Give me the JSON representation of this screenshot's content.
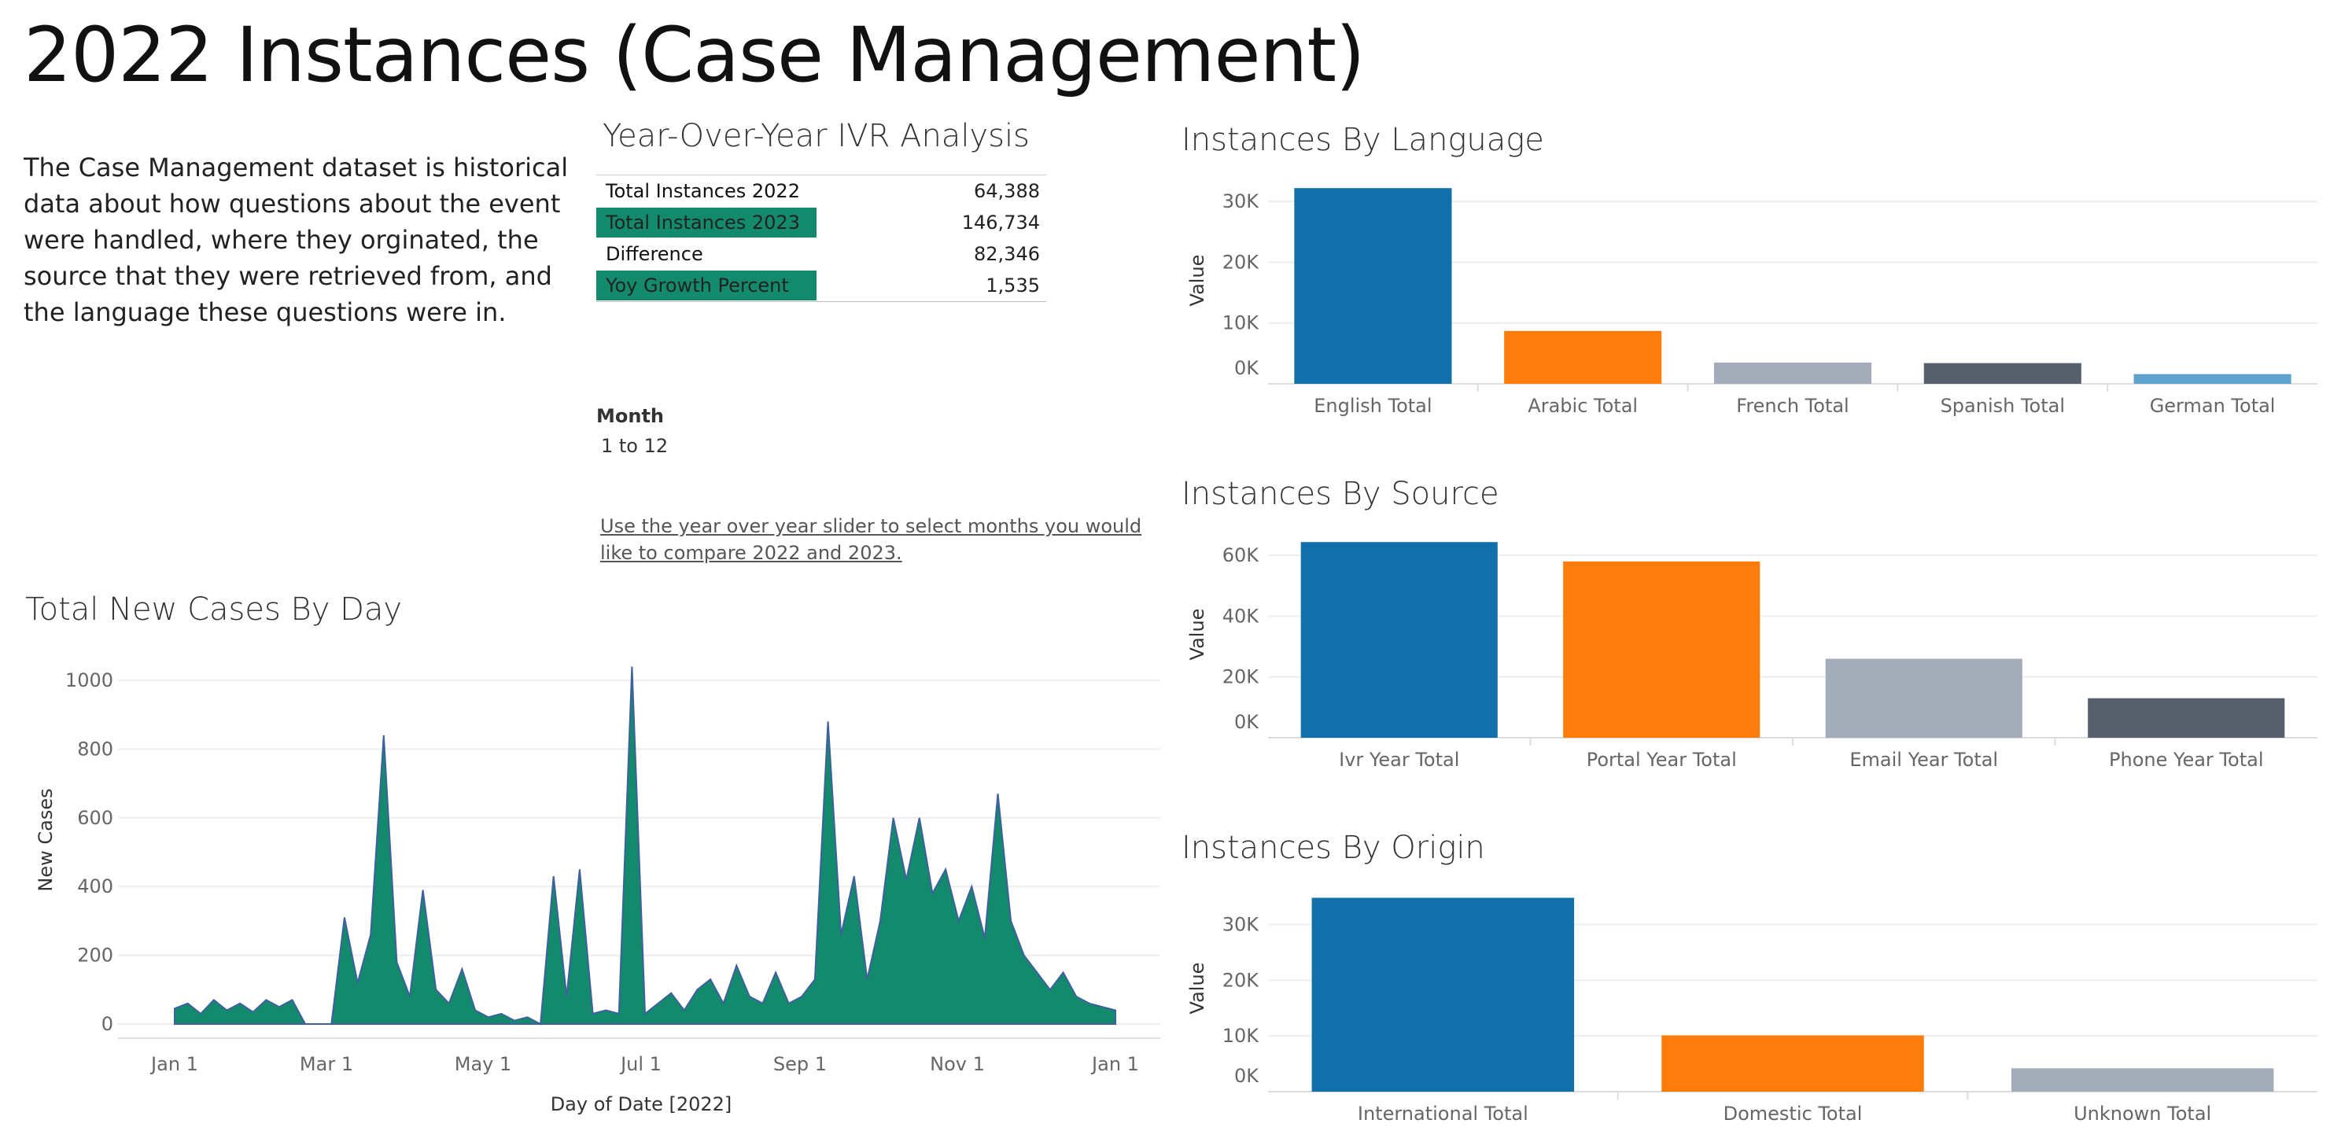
{
  "title": "2022 Instances (Case Management)",
  "description": "The Case Management dataset is historical data about how questions about the event were handled, where they orginated, the source that they were retrieved from, and the language these questions were in.",
  "yoy": {
    "title": "Year-Over-Year IVR Analysis",
    "rows": [
      {
        "label": "Total Instances 2022",
        "value": "64,388",
        "highlight": false
      },
      {
        "label": "Total Instances 2023",
        "value": "146,734",
        "highlight": true
      },
      {
        "label": "Difference",
        "value": "82,346",
        "highlight": false
      },
      {
        "label": "Yoy Growth Percent",
        "value": "1,535",
        "highlight": true
      }
    ]
  },
  "filter": {
    "label": "Month",
    "value": "1 to 12"
  },
  "hint": "Use the year over year slider to select months you would like to compare 2022 and 2023.",
  "colors": {
    "blue": "#1170aa",
    "orange": "#fc7d0b",
    "gray": "#a3acb9",
    "dark_gray": "#57606c",
    "light_blue": "#5fa2ce",
    "green": "#138a6b",
    "line": "#3f5f9e"
  },
  "chart_data": [
    {
      "id": "line",
      "type": "area",
      "title": "Total New Cases By Day",
      "xlabel": "Day of Date [2022]",
      "ylabel": "New Cases",
      "ylim": [
        0,
        1000
      ],
      "yticks": [
        "0",
        "200",
        "400",
        "600",
        "800",
        "1000"
      ],
      "xticks": [
        "Jan 1",
        "Mar 1",
        "May 1",
        "Jul 1",
        "Sep 1",
        "Nov 1",
        "Jan 1"
      ],
      "x": [
        "Jan 1",
        "Jan 6",
        "Jan 11",
        "Jan 16",
        "Jan 21",
        "Jan 26",
        "Jan 31",
        "Feb 5",
        "Feb 10",
        "Feb 15",
        "Feb 20",
        "Feb 25",
        "Mar 2",
        "Mar 7",
        "Mar 12",
        "Mar 17",
        "Mar 22",
        "Mar 27",
        "Apr 1",
        "Apr 6",
        "Apr 11",
        "Apr 16",
        "Apr 21",
        "Apr 26",
        "May 1",
        "May 6",
        "May 11",
        "May 16",
        "May 21",
        "May 26",
        "May 31",
        "Jun 5",
        "Jun 10",
        "Jun 15",
        "Jun 20",
        "Jun 25",
        "Jun 30",
        "Jul 5",
        "Jul 10",
        "Jul 15",
        "Jul 20",
        "Jul 25",
        "Jul 30",
        "Aug 4",
        "Aug 9",
        "Aug 14",
        "Aug 19",
        "Aug 24",
        "Aug 29",
        "Sep 3",
        "Sep 8",
        "Sep 13",
        "Sep 18",
        "Sep 23",
        "Sep 28",
        "Oct 3",
        "Oct 8",
        "Oct 13",
        "Oct 18",
        "Oct 23",
        "Oct 28",
        "Nov 2",
        "Nov 7",
        "Nov 12",
        "Nov 17",
        "Nov 22",
        "Nov 27",
        "Dec 2",
        "Dec 7",
        "Dec 12",
        "Dec 17",
        "Dec 22",
        "Dec 27"
      ],
      "series": [
        {
          "values": [
            45,
            60,
            30,
            70,
            40,
            60,
            35,
            70,
            50,
            70,
            0,
            0,
            0,
            310,
            120,
            260,
            840,
            180,
            80,
            390,
            100,
            60,
            160,
            40,
            20,
            30,
            10,
            20,
            0,
            430,
            80,
            450,
            30,
            40,
            30,
            1040,
            30,
            60,
            90,
            40,
            100,
            130,
            60,
            170,
            80,
            60,
            150,
            60,
            80,
            130,
            880,
            260,
            430,
            130,
            300,
            600,
            420,
            600,
            380,
            450,
            300,
            400,
            250,
            670,
            300,
            200,
            150,
            100,
            150,
            80,
            60,
            50,
            40
          ]
        }
      ]
    },
    {
      "id": "lang",
      "type": "bar",
      "title": "Instances By Language",
      "ylabel": "Value",
      "ylim": [
        0,
        33000
      ],
      "yticks": [
        "0K",
        "10K",
        "20K",
        "30K"
      ],
      "categories": [
        "English Total",
        "Arabic Total",
        "French Total",
        "Spanish Total",
        "German Total"
      ],
      "values": [
        32200,
        8700,
        3500,
        3400,
        1600
      ]
    },
    {
      "id": "src",
      "type": "bar",
      "title": "Instances By Source",
      "ylabel": "Value",
      "ylim": [
        0,
        66000
      ],
      "yticks": [
        "0K",
        "20K",
        "40K",
        "60K"
      ],
      "categories": [
        "Ivr Year Total",
        "Portal Year Total",
        "Email Year Total",
        "Phone Year Total"
      ],
      "values": [
        64388,
        58000,
        26000,
        13000
      ]
    },
    {
      "id": "orig",
      "type": "bar",
      "title": "Instances By Origin",
      "ylabel": "Value",
      "ylim": [
        0,
        36000
      ],
      "yticks": [
        "0K",
        "10K",
        "20K",
        "30K"
      ],
      "categories": [
        "International Total",
        "Domestic Total",
        "Unknown Total"
      ],
      "values": [
        34800,
        10100,
        4200
      ]
    }
  ]
}
